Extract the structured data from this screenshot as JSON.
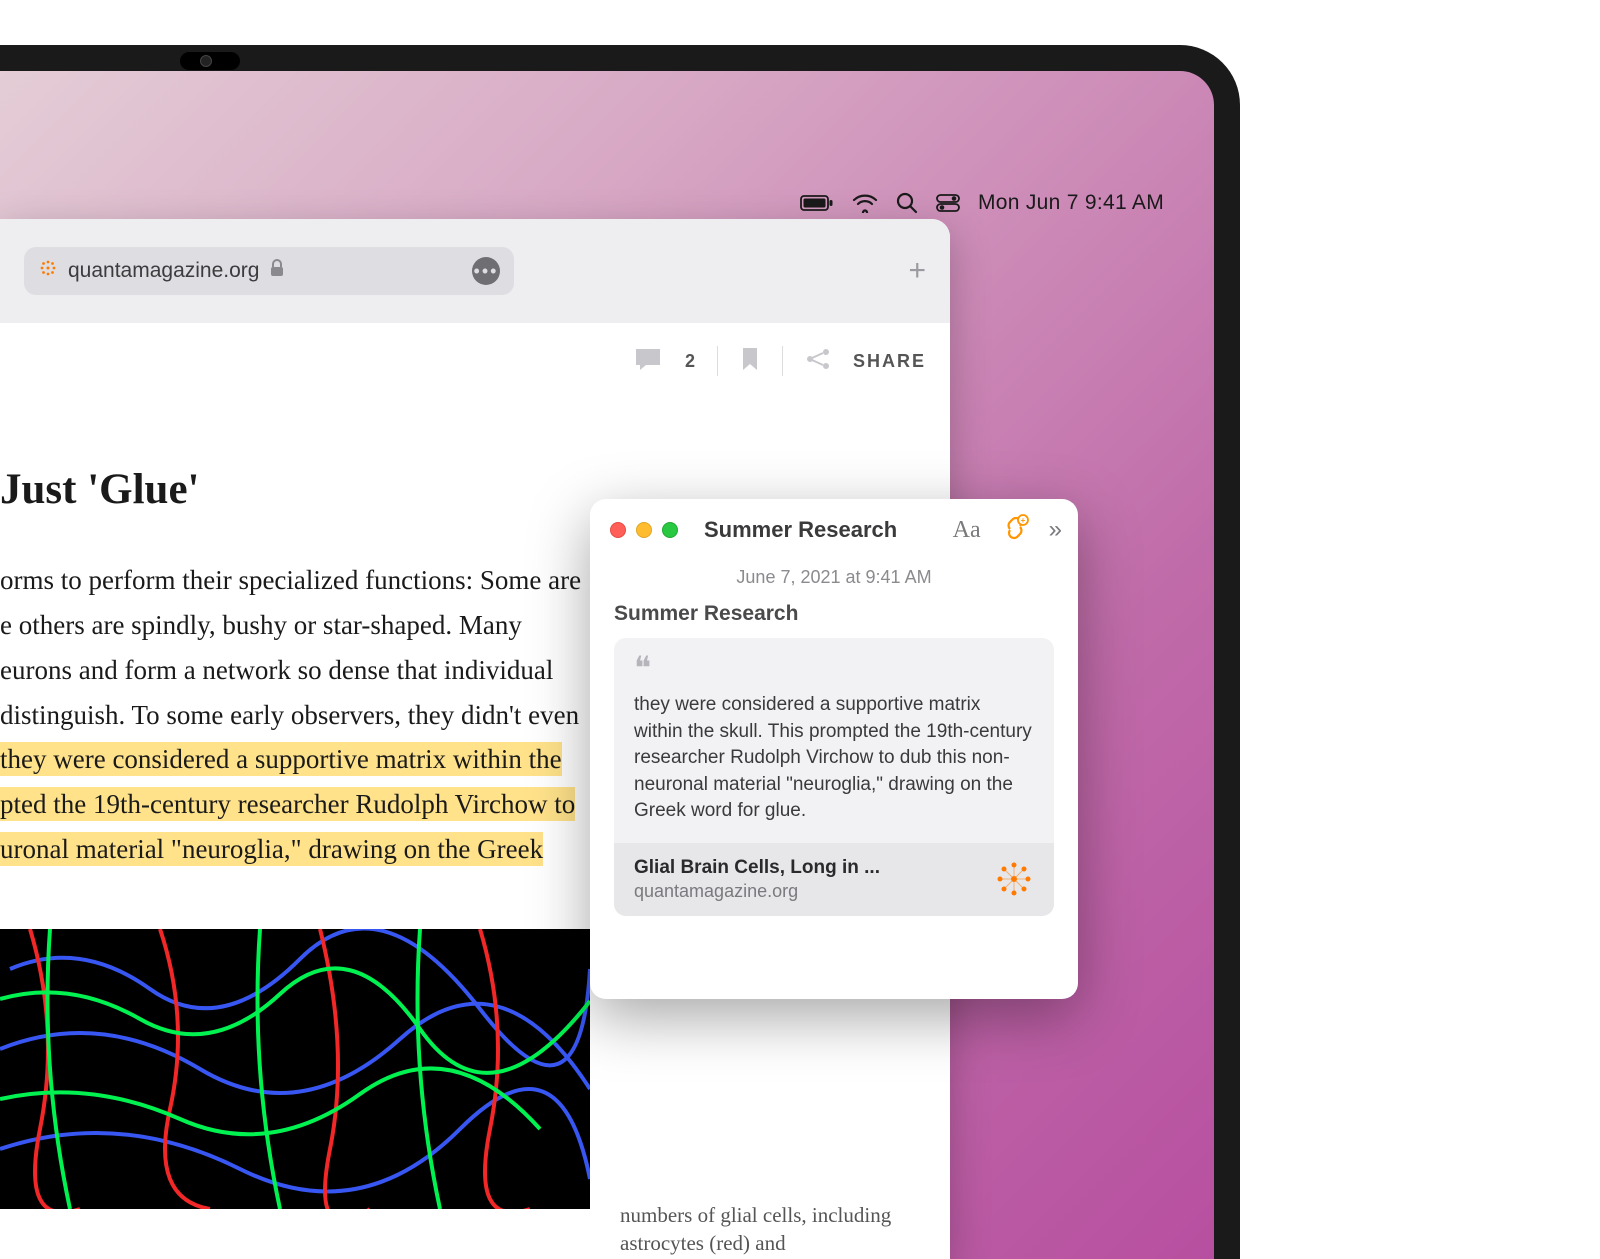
{
  "menubar": {
    "datetime": "Mon Jun 7  9:41 AM"
  },
  "safari": {
    "url": "quantamagazine.org",
    "actions": {
      "comment_count": "2",
      "share_label": "SHARE"
    },
    "article": {
      "title_fragment": "Just 'Glue'",
      "body_fragment_1": "orms to perform their specialized functions: Some are",
      "body_fragment_2": "e others are spindly, bushy or star-shaped. Many",
      "body_fragment_3": "eurons and form a network so dense that individual",
      "body_fragment_4": "distinguish. To some early observers, they didn't even",
      "body_highlight_1": " they were considered a supportive matrix within the",
      "body_highlight_2": "pted the 19th-century researcher Rudolph Virchow to",
      "body_highlight_3": "uronal material \"neuroglia,\" drawing on the Greek",
      "caption_fragment": "numbers of glial cells, including astrocytes (red) and"
    }
  },
  "notes": {
    "window_title": "Summer Research",
    "timestamp": "June 7, 2021 at 9:41 AM",
    "note_title": "Summer Research",
    "quote_text": "they were considered a supportive matrix within the skull. This prompted the 19th-century researcher Rudolph Virchow to dub this non-neuronal material \"neuroglia,\" drawing on the Greek word for glue.",
    "source_title": "Glial Brain Cells, Long in ...",
    "source_domain": "quantamagazine.org"
  }
}
